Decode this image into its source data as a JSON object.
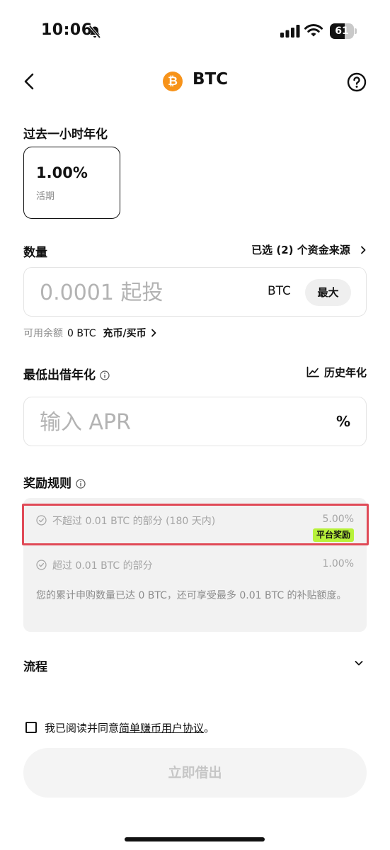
{
  "status_bar": {
    "time": "10:06",
    "battery": "61",
    "battery_level": 0.61
  },
  "header": {
    "title": "BTC",
    "coin_symbol": "₿"
  },
  "apy_section": {
    "title": "过去一小时年化",
    "value": "1.00%",
    "term": "活期"
  },
  "amount_section": {
    "title": "数量",
    "source_link": "已选 (2) 个资金来源",
    "placeholder": "0.0001 起投",
    "unit": "BTC",
    "max_label": "最大",
    "available_label": "可用余额",
    "available_value": "0 BTC",
    "deposit_link": "充币/买币"
  },
  "rate_section": {
    "title": "最低出借年化",
    "history_link": "历史年化",
    "placeholder": "输入 APR",
    "unit": "%"
  },
  "rules_section": {
    "title": "奖励规则",
    "rows": [
      {
        "label": "不超过 0.01 BTC 的部分 (180 天内)",
        "rate": "5.00%",
        "badge": "平台奖励"
      },
      {
        "label": "超过 0.01 BTC 的部分",
        "rate": "1.00%"
      }
    ],
    "note": "您的累计申购数量已达 0 BTC，还可享受最多 0.01 BTC 的补贴额度。"
  },
  "flow_section": {
    "title": "流程"
  },
  "agreement": {
    "prefix": "我已阅读并同意",
    "link": "简单赚币用户协议",
    "suffix": "。"
  },
  "submit_label": "立即借出",
  "colors": {
    "brand": "#f7931a",
    "badge": "#b8f23a",
    "highlight": "#e04a57"
  }
}
